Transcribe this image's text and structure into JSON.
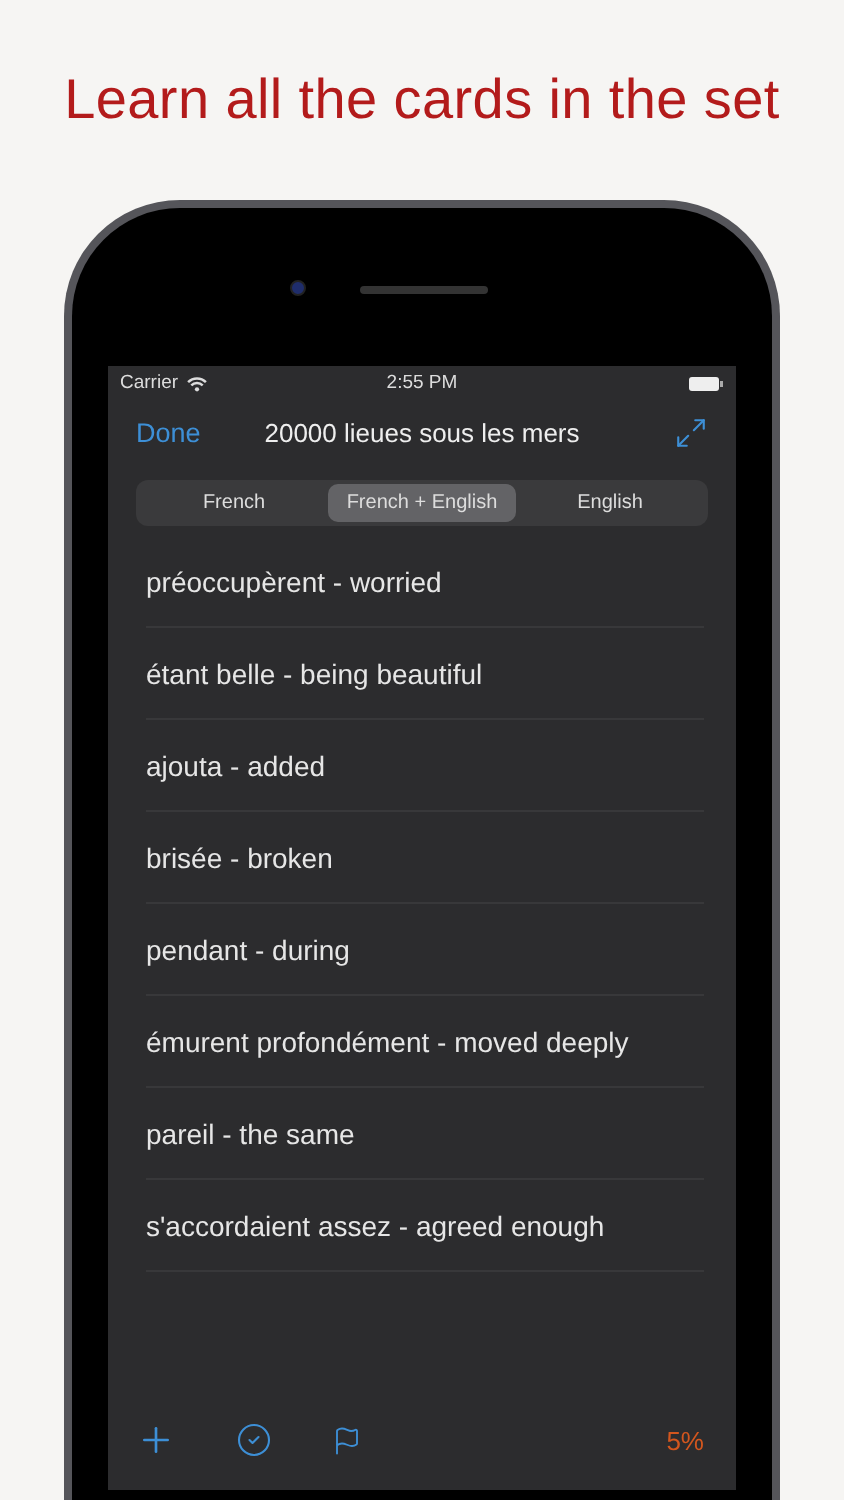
{
  "headline": "Learn all the cards in the set",
  "status_bar": {
    "carrier": "Carrier",
    "time": "2:55 PM"
  },
  "nav": {
    "done": "Done",
    "title": "20000 lieues sous les mers"
  },
  "segments": [
    {
      "label": "French",
      "selected": false
    },
    {
      "label": "French + English",
      "selected": true
    },
    {
      "label": "English",
      "selected": false
    }
  ],
  "cards": [
    {
      "text": "préoccupèrent - worried"
    },
    {
      "text": "étant belle - being beautiful"
    },
    {
      "text": "ajouta - added"
    },
    {
      "text": "brisée - broken"
    },
    {
      "text": "pendant - during"
    },
    {
      "text": "émurent profondément - moved deeply"
    },
    {
      "text": "pareil - the same"
    },
    {
      "text": "s'accordaient assez - agreed enough"
    }
  ],
  "toolbar": {
    "progress": "5%"
  }
}
